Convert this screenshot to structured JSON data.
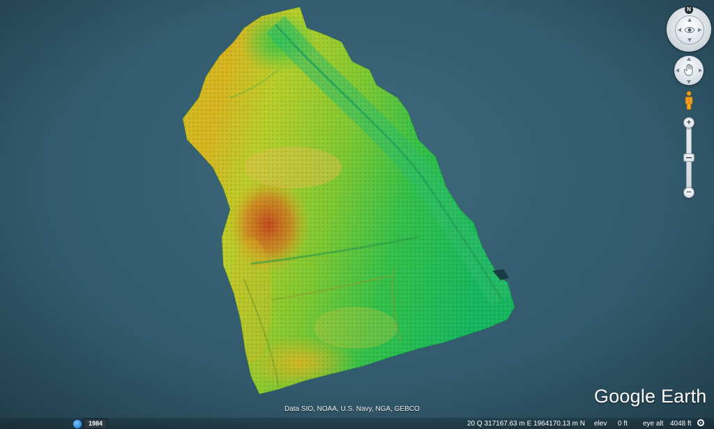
{
  "map": {
    "overlay": "digital elevation model",
    "colors": {
      "low": "#1fbf4a",
      "mid": "#a7d42a",
      "high": "#e2b21d",
      "peak": "#cf5a1e",
      "ocean": "#345e70"
    }
  },
  "controls": {
    "north_label": "N",
    "zoom_in_label": "+",
    "zoom_out_label": "−",
    "icons": [
      "eye-icon",
      "hand-icon",
      "pegman-icon",
      "history-clock-icon",
      "streaming-icon"
    ]
  },
  "branding": {
    "logo_text": "Google Earth",
    "attribution": "Data SIO, NOAA, U.S. Navy, NGA, GEBCO"
  },
  "status_bar": {
    "year": "1984",
    "coordinates": "20 Q 317167.63 m E 1964170.13 m N",
    "elev_label": "elev",
    "elev_value": "0 ft",
    "eye_alt_label": "eye alt",
    "eye_alt_value": "4048 ft"
  }
}
